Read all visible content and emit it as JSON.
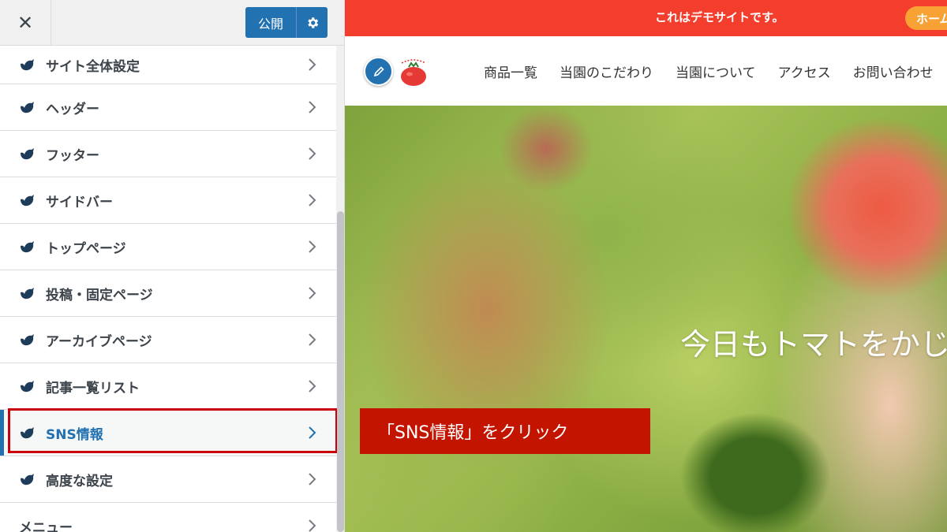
{
  "sidebar": {
    "close_label": "✕",
    "publish_label": "公開",
    "items": [
      {
        "label": "サイト全体設定"
      },
      {
        "label": "ヘッダー"
      },
      {
        "label": "フッター"
      },
      {
        "label": "サイドバー"
      },
      {
        "label": "トップページ"
      },
      {
        "label": "投稿・固定ページ"
      },
      {
        "label": "アーカイブページ"
      },
      {
        "label": "記事一覧リスト"
      },
      {
        "label": "SNS情報"
      },
      {
        "label": "高度な設定"
      },
      {
        "label": "メニュー"
      }
    ],
    "active_item": "SNS情報"
  },
  "preview": {
    "notice": "これはデモサイトです。",
    "home_button": "ホーム",
    "nav": [
      "商品一覧",
      "当園のこだわり",
      "当園について",
      "アクセス",
      "お問い合わせ"
    ],
    "hero_text": "今日もトマトをかじる",
    "callout": "「SNS情報」をクリック"
  },
  "colors": {
    "accent": "#2271b1",
    "topbar": "#f33d2d",
    "home_pill": "#f8a236",
    "callout": "#c31400",
    "highlight_border": "#c9000b"
  },
  "icons": {
    "close": "close-icon",
    "publish_settings": "gear-icon",
    "item": "bird-icon",
    "chevron": "chevron-right-icon",
    "edit": "pencil-icon",
    "logo": "tomato-logo"
  }
}
